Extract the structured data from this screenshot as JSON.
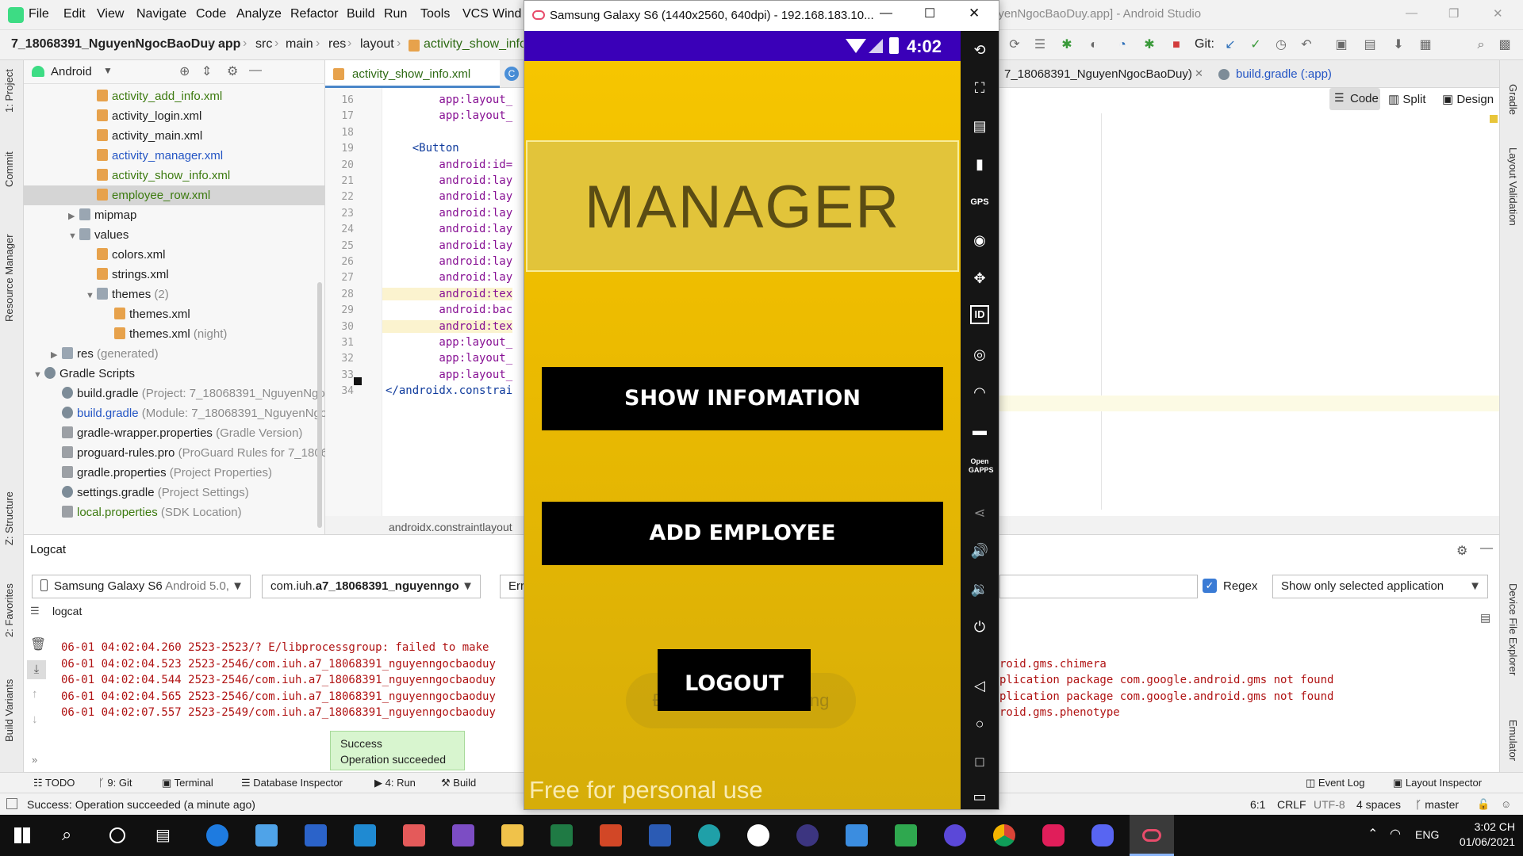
{
  "menu": {
    "items": [
      "File",
      "Edit",
      "View",
      "Navigate",
      "Code",
      "Analyze",
      "Refactor",
      "Build",
      "Run",
      "Tools",
      "VCS",
      "Wind"
    ],
    "window_title": "uyenNgocBaoDuy.app] - Android Studio"
  },
  "nav": {
    "project": "7_18068391_NguyenNgocBaoDuy",
    "crumbs": [
      "app",
      "src",
      "main",
      "res",
      "layout"
    ],
    "file": "activity_show_info.",
    "run_config": "7_18068391_NguyenNgocBaoDuy)",
    "git_label": "Git:",
    "gradle_tab": "build.gradle (:app)"
  },
  "view_modes": {
    "code": "Code",
    "split": "Split",
    "design": "Design"
  },
  "left_stripe": {
    "project": "1: Project",
    "commit": "Commit",
    "resource": "Resource Manager",
    "structure": "Z: Structure",
    "favorites": "2: Favorites",
    "variants": "Build Variants"
  },
  "right_stripe": {
    "gradle": "Gradle",
    "layout_validation": "Layout Validation",
    "device_explorer": "Device File Explorer",
    "emulator": "Emulator"
  },
  "project_panel": {
    "view": "Android",
    "tree": [
      {
        "label": "activity_add_info.xml",
        "extra": "",
        "type": "xml",
        "indent": 3,
        "color": "green"
      },
      {
        "label": "activity_login.xml",
        "extra": "",
        "type": "xml",
        "indent": 3,
        "color": ""
      },
      {
        "label": "activity_main.xml",
        "extra": "",
        "type": "xml",
        "indent": 3,
        "color": ""
      },
      {
        "label": "activity_manager.xml",
        "extra": "",
        "type": "xml",
        "indent": 3,
        "color": "blue"
      },
      {
        "label": "activity_show_info.xml",
        "extra": "",
        "type": "xml",
        "indent": 3,
        "color": "green"
      },
      {
        "label": "employee_row.xml",
        "extra": "",
        "type": "xml",
        "indent": 3,
        "color": "green",
        "selected": true
      },
      {
        "label": "mipmap",
        "extra": "",
        "type": "dir",
        "indent": 2,
        "arrow": "▶"
      },
      {
        "label": "values",
        "extra": "",
        "type": "dir",
        "indent": 2,
        "arrow": "▼"
      },
      {
        "label": "colors.xml",
        "extra": "",
        "type": "xml",
        "indent": 3,
        "color": ""
      },
      {
        "label": "strings.xml",
        "extra": "",
        "type": "xml",
        "indent": 3,
        "color": ""
      },
      {
        "label": "themes",
        "extra": " (2)",
        "type": "dir",
        "indent": 3,
        "arrow": "▼"
      },
      {
        "label": "themes.xml",
        "extra": "",
        "type": "xml",
        "indent": 4,
        "color": ""
      },
      {
        "label": "themes.xml",
        "extra": " (night)",
        "type": "xml",
        "indent": 4,
        "color": ""
      },
      {
        "label": "res",
        "extra": " (generated)",
        "type": "dir",
        "indent": 1,
        "arrow": "▶"
      },
      {
        "label": "Gradle Scripts",
        "extra": "",
        "type": "gradle",
        "indent": 0,
        "arrow": "▼"
      },
      {
        "label": "build.gradle",
        "extra": " (Project: 7_18068391_NguyenNgoc",
        "type": "gradle",
        "indent": 1,
        "color": ""
      },
      {
        "label": "build.gradle",
        "extra": " (Module: 7_18068391_NguyenNgo",
        "type": "gradle",
        "indent": 1,
        "color": "blue"
      },
      {
        "label": "gradle-wrapper.properties",
        "extra": " (Gradle Version)",
        "type": "prop",
        "indent": 1,
        "color": ""
      },
      {
        "label": "proguard-rules.pro",
        "extra": " (ProGuard Rules for 7_1806",
        "type": "prop",
        "indent": 1,
        "color": ""
      },
      {
        "label": "gradle.properties",
        "extra": " (Project Properties)",
        "type": "prop",
        "indent": 1,
        "color": ""
      },
      {
        "label": "settings.gradle",
        "extra": " (Project Settings)",
        "type": "gradle",
        "indent": 1,
        "color": ""
      },
      {
        "label": "local.properties",
        "extra": " (SDK Location)",
        "type": "prop",
        "indent": 1,
        "color": "green"
      }
    ]
  },
  "editor": {
    "tab": "activity_show_info.xml",
    "lines": [
      {
        "n": "16",
        "t": "        app:layout_"
      },
      {
        "n": "17",
        "t": "        app:layout_"
      },
      {
        "n": "18",
        "t": ""
      },
      {
        "n": "19",
        "t": "    <Button"
      },
      {
        "n": "20",
        "t": "        android:id="
      },
      {
        "n": "21",
        "t": "        android:lay"
      },
      {
        "n": "22",
        "t": "        android:lay"
      },
      {
        "n": "23",
        "t": "        android:lay"
      },
      {
        "n": "24",
        "t": "        android:lay"
      },
      {
        "n": "25",
        "t": "        android:lay"
      },
      {
        "n": "26",
        "t": "        android:lay"
      },
      {
        "n": "27",
        "t": "        android:lay"
      },
      {
        "n": "28",
        "t": "        android:tex"
      },
      {
        "n": "29",
        "t": "        android:bac"
      },
      {
        "n": "30",
        "t": "        android:tex"
      },
      {
        "n": "31",
        "t": "        app:layout_"
      },
      {
        "n": "32",
        "t": "        app:layout_"
      },
      {
        "n": "33",
        "t": "        app:layout_"
      },
      {
        "n": "34",
        "t": "</androidx.constrai"
      }
    ],
    "footer": "androidx.constraintlayout"
  },
  "logcat": {
    "title": "Logcat",
    "device": "Samsung Galaxy S6",
    "device_extra": " Android 5.0,",
    "process_prefix": "com.iuh.",
    "process_bold": "a7_18068391_nguyenngoc",
    "level": "Err",
    "regex_label": "Regex",
    "filter": "Show only selected application",
    "sub": "logcat",
    "lines": [
      {
        "left": "06-01 04:02:04.260 2523-2523/? E/libprocessgroup: failed to make",
        "right": ""
      },
      {
        "left": "06-01 04:02:04.523 2523-2546/com.iuh.a7_18068391_nguyenngocbaoduy",
        "right": "roid.gms.chimera"
      },
      {
        "left": "06-01 04:02:04.544 2523-2546/com.iuh.a7_18068391_nguyenngocbaoduy",
        "right": "plication package com.google.android.gms not found"
      },
      {
        "left": "06-01 04:02:04.565 2523-2546/com.iuh.a7_18068391_nguyenngocbaoduy",
        "right": "plication package com.google.android.gms not found"
      },
      {
        "left": "06-01 04:02:07.557 2523-2549/com.iuh.a7_18068391_nguyenngocbaoduy",
        "right": "roid.gms.phenotype"
      }
    ]
  },
  "toast": {
    "title": "Success",
    "message": "Operation succeeded"
  },
  "bottom_tools": {
    "todo": "TODO",
    "git": "9: Git",
    "terminal": "Terminal",
    "db": "Database Inspector",
    "run": "4: Run",
    "build": "Build",
    "event_log": "Event Log",
    "layout_inspector": "Layout Inspector"
  },
  "status": {
    "message": "Success: Operation succeeded (a minute ago)",
    "pos": "6:1",
    "crlf": "CRLF",
    "enc": "UTF-8",
    "indent": "4 spaces",
    "branch": "master"
  },
  "emulator": {
    "title": "Samsung Galaxy S6 (1440x2560, 640dpi) - 192.168.183.10...",
    "time": "4:02",
    "banner": "MANAGER",
    "btn_show": "SHOW INFOMATION",
    "btn_add": "ADD EMPLOYEE",
    "btn_logout": "LOGOUT",
    "hint": "Đăng nhập thành công",
    "watermark": "Free for personal use",
    "open_gapps": "Open GAPPS"
  },
  "taskbar": {
    "lang": "ENG",
    "time": "3:02 CH",
    "date": "01/06/2021"
  }
}
